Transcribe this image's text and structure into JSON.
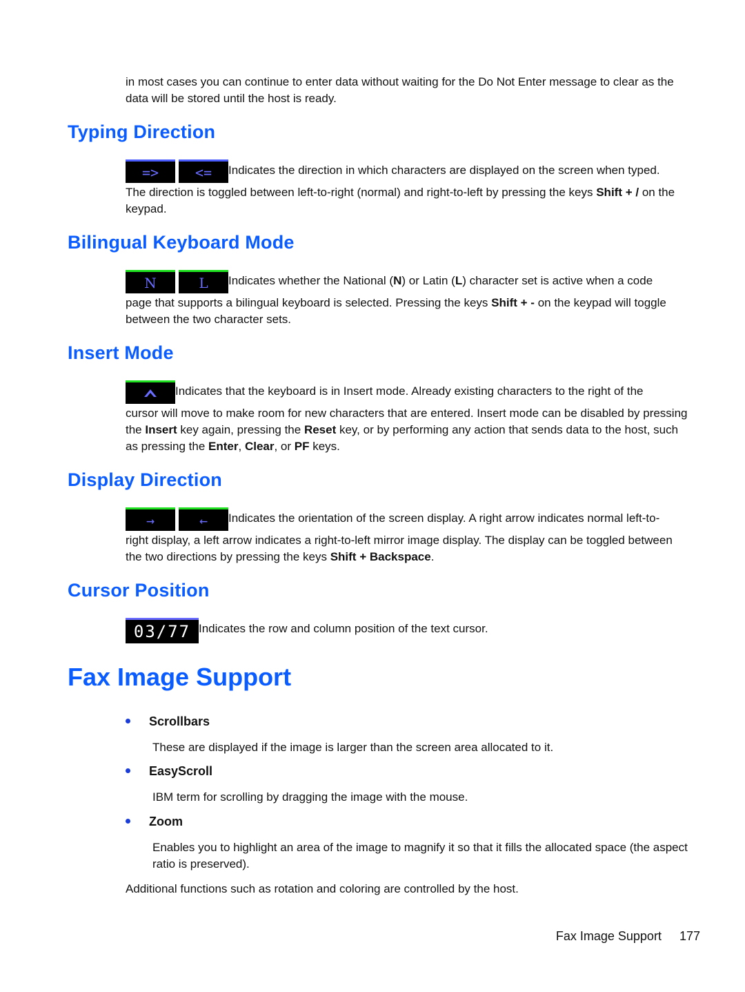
{
  "intro": "in most cases you can continue to enter data without waiting for the Do Not Enter message to clear as the data will be stored until the host is ready.",
  "sections": {
    "typing": {
      "title": "Typing Direction",
      "indicators": [
        "=>",
        "<="
      ],
      "lead": "Indicates the direction in which characters are displayed on the screen when typed.",
      "body_pre": "The direction is toggled between left-to-right (normal) and right-to-left by pressing the keys ",
      "body_key": "Shift + /",
      "body_post": " on the keypad."
    },
    "bilingual": {
      "title": "Bilingual Keyboard Mode",
      "indicators": [
        "N",
        "L"
      ],
      "lead_a": "Indicates whether the National (",
      "lead_n": "N",
      "lead_b": ") or Latin (",
      "lead_l": "L",
      "lead_c": ") character set is active when a code",
      "body_pre": "page that supports a bilingual keyboard is selected. Pressing the keys ",
      "body_key": "Shift + -",
      "body_post": " on the keypad will toggle between the two character sets."
    },
    "insert": {
      "title": "Insert Mode",
      "indicator_icon": "caret-up-icon",
      "lead": "Indicates that the keyboard is in Insert mode. Already existing characters to the right of the",
      "body_1": "cursor will move to make room for new characters that are entered. Insert mode can be disabled by pressing the ",
      "k_insert": "Insert",
      "body_2": " key again, pressing the ",
      "k_reset": "Reset",
      "body_3": " key, or by performing any action that sends data to the host, such as pressing the ",
      "k_enter": "Enter",
      "sep1": ", ",
      "k_clear": "Clear",
      "sep2": ", or ",
      "k_pf": "PF",
      "body_4": " keys."
    },
    "display": {
      "title": "Display Direction",
      "indicators": [
        "→",
        "←"
      ],
      "lead": "Indicates the orientation of the screen display. A right arrow indicates normal left-to-",
      "body_pre": "right display, a left arrow indicates a right-to-left mirror image display. The display can be toggled between the two directions by pressing the keys ",
      "body_key": "Shift + Backspace",
      "body_post": "."
    },
    "cursor": {
      "title": "Cursor Position",
      "indicator": "03/77",
      "lead": "Indicates the row and column position of the text cursor."
    }
  },
  "fax": {
    "title": "Fax Image Support",
    "items": [
      {
        "term": "Scrollbars",
        "desc": "These are displayed if the image is larger than the screen area allocated to it."
      },
      {
        "term": "EasyScroll",
        "desc": "IBM term for scrolling by dragging the image with the mouse."
      },
      {
        "term": "Zoom",
        "desc": "Enables you to highlight an area of the image to magnify it so that it fills the allocated space (the aspect ratio is preserved)."
      }
    ],
    "closing": "Additional functions such as rotation and coloring are controlled by the host."
  },
  "footer": {
    "section": "Fax Image Support",
    "page": "177"
  }
}
